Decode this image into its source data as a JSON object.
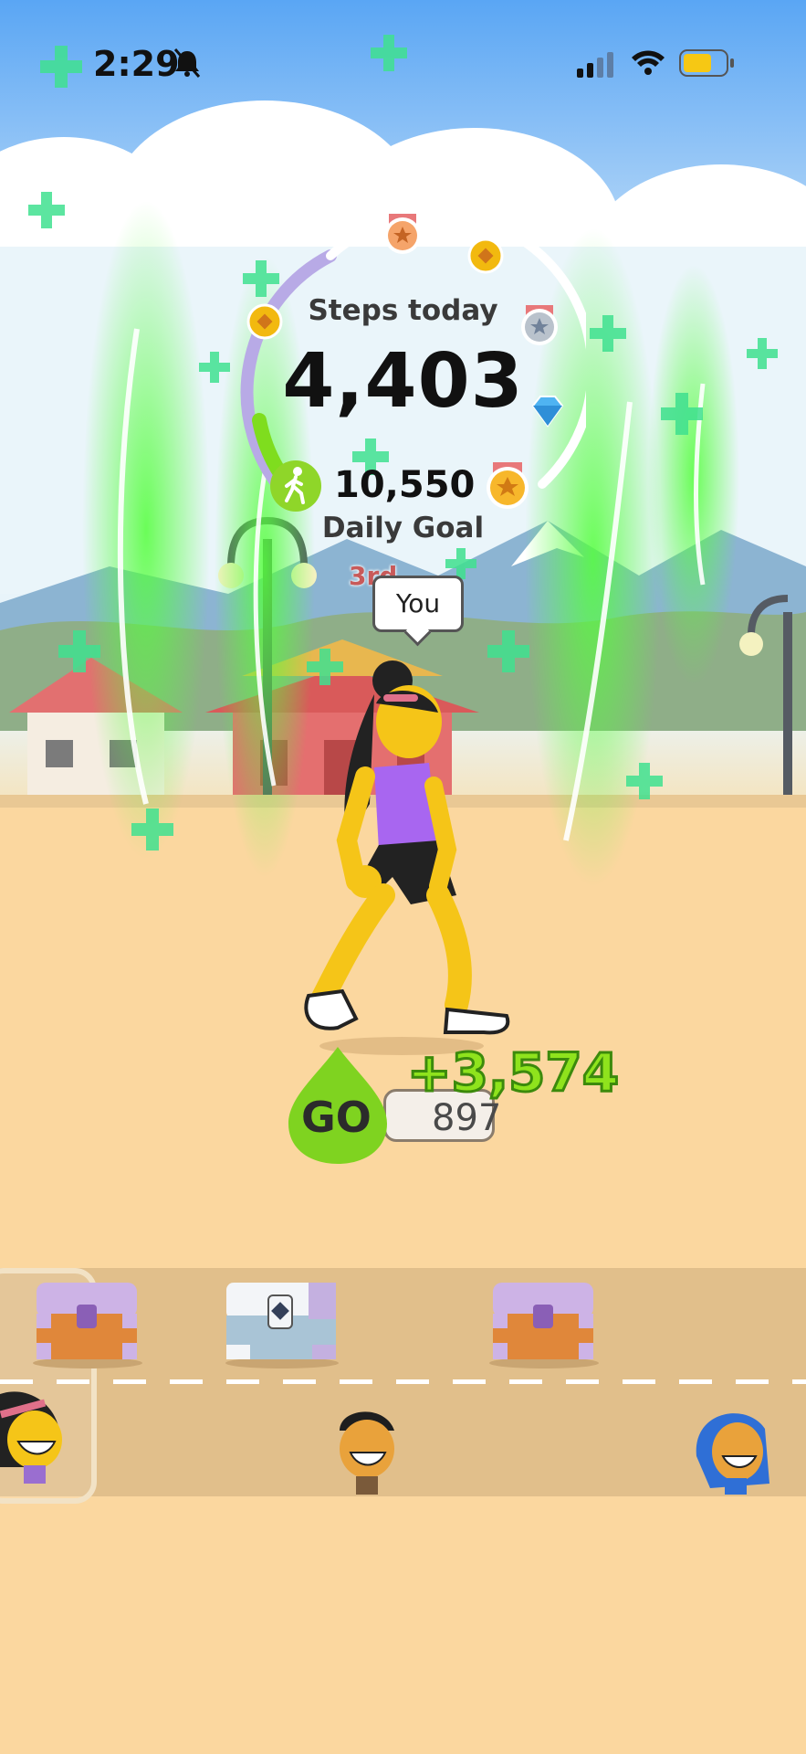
{
  "status_bar": {
    "time": "2:29"
  },
  "ring": {
    "steps_label": "Steps today",
    "steps_value": "4,403",
    "goal_value": "10,550",
    "goal_label": "Daily Goal"
  },
  "player": {
    "rank": "3rd",
    "name_bubble": "You"
  },
  "coins": {
    "go_label": "GO",
    "balance": "897",
    "gain": "+3,574"
  },
  "colors": {
    "ring_progress": "#7fdd1e",
    "ring_track_purple": "#b8aae6",
    "go_green": "#7fd320",
    "sand": "#fbd79f"
  }
}
